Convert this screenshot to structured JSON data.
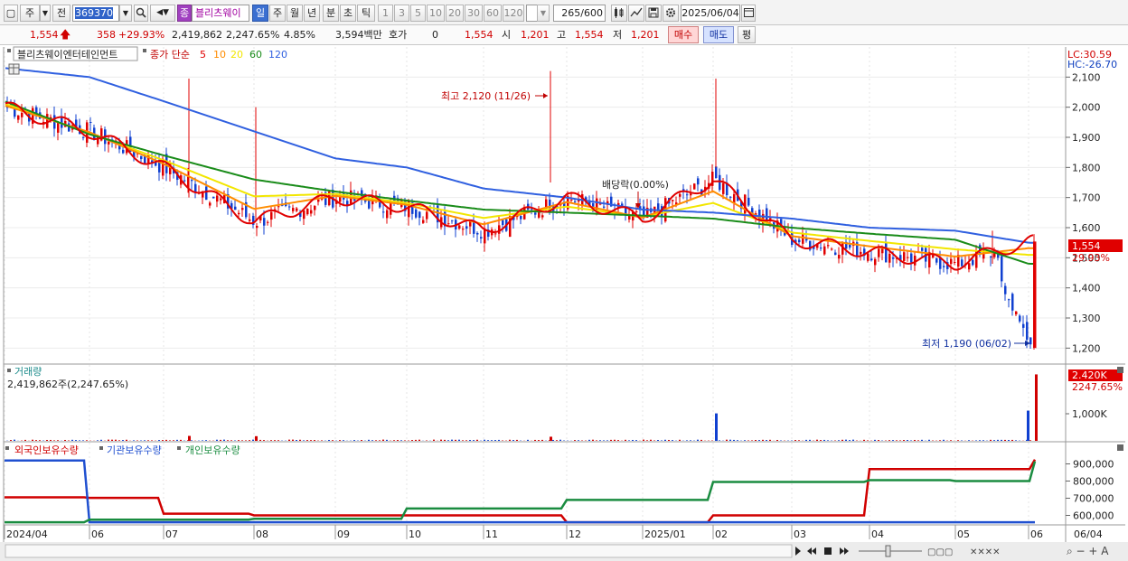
{
  "toolbar": {
    "period_btn": "주",
    "prev_btn": "전",
    "stock_code": "369370",
    "stock_name_badge": "종",
    "stock_name": "블리츠웨이",
    "period_tabs": [
      "일",
      "주",
      "월",
      "년",
      "분",
      "초",
      "틱"
    ],
    "interval_tabs": [
      "1",
      "3",
      "5",
      "10",
      "20",
      "30",
      "60",
      "120"
    ],
    "count": "265",
    "count_total": "/600",
    "date": "2025/06/04"
  },
  "quote": {
    "price": "1,554",
    "change": "358",
    "change_pct": "+29.93%",
    "volume": "2,419,862",
    "volume_pct": "2,247.65%",
    "turnover_pct": "4.85%",
    "amount": "3,594백만",
    "hoga_label": "호가",
    "hoga_value": "0",
    "hoga_price": "1,554",
    "open_label": "시",
    "open": "1,201",
    "high_label": "고",
    "high": "1,554",
    "low_label": "저",
    "low": "1,201",
    "buy_btn": "매수",
    "sell_btn": "매도",
    "eval_btn": "평"
  },
  "price_pane": {
    "stock_label": "블리츠웨이엔터테인먼트",
    "ma_label": "종가 단순",
    "ma_periods": [
      "5",
      "10",
      "20",
      "60",
      "120"
    ],
    "ma_colors": [
      "#e00000",
      "#ff8c00",
      "#f2e600",
      "#1a8c1a",
      "#3060e0"
    ],
    "lc_label": "LC:30.59",
    "hc_label": "HC:-26.70",
    "high_annotation": "최고 2,120 (11/26)",
    "dividend_annotation": "배당락(0.00%)",
    "low_annotation": "최저 1,190 (06/02)",
    "current_price_badge": "1,554",
    "current_pct": "29.93%",
    "y_ticks": [
      "2,100",
      "2,000",
      "1,900",
      "1,800",
      "1,700",
      "1,600",
      "1,500",
      "1,400",
      "1,300",
      "1,200"
    ]
  },
  "volume_pane": {
    "title": "거래량",
    "value_text": "2,419,862주(2,247.65%)",
    "badge": "2.420K",
    "badge_pct": "2247.65%",
    "y_tick": "1,000K"
  },
  "holding_pane": {
    "legend": [
      {
        "label": "외국인보유수량",
        "color": "#d00000"
      },
      {
        "label": "기관보유수량",
        "color": "#2050d0"
      },
      {
        "label": "개인보유수량",
        "color": "#1a8c40"
      }
    ],
    "y_ticks": [
      "900,000",
      "800,000",
      "700,000",
      "600,000"
    ]
  },
  "x_axis": {
    "labels": [
      "2024/04",
      "06",
      "07",
      "08",
      "09",
      "10",
      "11",
      "12",
      "2025/01",
      "02",
      "03",
      "04",
      "05",
      "06"
    ],
    "end_label": "06/04"
  },
  "chart_data": [
    {
      "type": "candlestick",
      "title": "블리츠웨이엔터테인먼트",
      "ylim": [
        1150,
        2200
      ],
      "series": [
        {
          "name": "5",
          "x": [
            "2024/04",
            "2024/06",
            "2024/07",
            "2024/08",
            "2024/09",
            "2024/10",
            "2024/11",
            "2024/12",
            "2025/01",
            "2025/02",
            "2025/03",
            "2025/04",
            "2025/05",
            "2025/06"
          ],
          "values": [
            2000,
            1920,
            1800,
            1620,
            1700,
            1670,
            1590,
            1700,
            1630,
            1760,
            1560,
            1520,
            1480,
            1554
          ]
        },
        {
          "name": "60",
          "x": [
            "2024/04",
            "2024/06",
            "2024/07",
            "2024/08",
            "2024/09",
            "2024/10",
            "2024/11",
            "2024/12",
            "2025/01",
            "2025/02",
            "2025/03",
            "2025/04",
            "2025/05",
            "2025/06"
          ],
          "values": [
            2020,
            1910,
            1840,
            1760,
            1720,
            1690,
            1660,
            1650,
            1640,
            1630,
            1600,
            1580,
            1560,
            1480
          ]
        },
        {
          "name": "120",
          "x": [
            "2024/04",
            "2024/06",
            "2024/07",
            "2024/08",
            "2024/09",
            "2024/10",
            "2024/11",
            "2024/12",
            "2025/01",
            "2025/02",
            "2025/03",
            "2025/04",
            "2025/05",
            "2025/06"
          ],
          "values": [
            2130,
            2100,
            2020,
            1920,
            1830,
            1800,
            1730,
            1700,
            1660,
            1650,
            1630,
            1600,
            1590,
            1550
          ]
        }
      ],
      "annotations": [
        {
          "x": "11/26",
          "y": 2120,
          "text": "최고 2,120 (11/26)"
        },
        {
          "x": "06/02",
          "y": 1190,
          "text": "최저 1,190 (06/02)"
        }
      ]
    },
    {
      "type": "bar",
      "title": "거래량",
      "ylim": [
        0,
        2500000
      ],
      "x": [
        "2024/07",
        "2024/08",
        "2024/11",
        "2025/02",
        "2025/06/03",
        "2025/06/04"
      ],
      "values": [
        180000,
        170000,
        150000,
        1000000,
        1100000,
        2419862
      ]
    },
    {
      "type": "line",
      "ylim": [
        550000,
        950000
      ],
      "x": [
        "2024/04",
        "2024/06",
        "2024/07",
        "2024/08",
        "2024/10",
        "2024/12",
        "2025/02",
        "2025/04",
        "2025/05",
        "2025/06"
      ],
      "series": [
        {
          "name": "외국인보유수량",
          "values": [
            705000,
            702000,
            610000,
            600000,
            600000,
            560000,
            600000,
            870000,
            870000,
            925000
          ]
        },
        {
          "name": "기관보유수량",
          "values": [
            920000,
            560000,
            560000,
            560000,
            560000,
            560000,
            560000,
            560000,
            560000,
            560000
          ]
        },
        {
          "name": "개인보유수량",
          "values": [
            560000,
            575000,
            575000,
            580000,
            640000,
            690000,
            795000,
            805000,
            800000,
            915000
          ]
        }
      ]
    }
  ]
}
